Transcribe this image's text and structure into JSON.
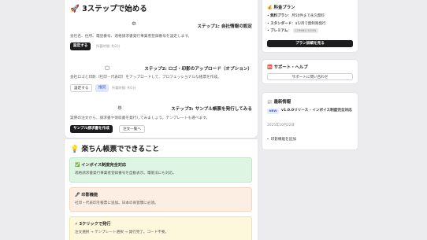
{
  "main": {
    "title": "🚀 3ステップで始める",
    "steps": [
      {
        "icon": "⚙",
        "title": "ステップ1: 会社情報の設定",
        "desc": "会社名、住所、電話番号、適格請求書発行事業者登録番号を設定します。",
        "button": "設定する",
        "hint": "所要時間: 約2分"
      },
      {
        "icon": "▢",
        "title": "ステップ2: ロゴ・印影のアップロード（オプション）",
        "desc": "会社ロゴと印影（社印・代表印）をアップロードして、プロフェッショナルな帳票を作成。",
        "button": "設定する",
        "button2": "推奨",
        "hint": "所要時間: 約1分"
      },
      {
        "icon": "⚙",
        "title": "ステップ3: サンプル帳票を発行してみる",
        "desc": "実際の注文から、請求書や領収書を発行してみましょう。テンプレートも選べます。",
        "button": "サンプル請求書を作成",
        "button2": "注文一覧へ"
      }
    ]
  },
  "features": {
    "title": "💡 楽ちん帳票でできること",
    "items": [
      {
        "title": "✅ インボイス制度完全対応",
        "desc": "適格請求書発行事業者登録番号を自動表示。電帳法にも対応。"
      },
      {
        "title": "🖊 印影機能",
        "desc": "社印・代表印を帳票に追加。日本の商習慣に必須。"
      },
      {
        "title": "⚡ 3クリックで発行",
        "desc": "注文選択 → テンプレート選択 → 発行完了。コード不要。"
      }
    ]
  },
  "sidebar": {
    "plan": {
      "title": "💰 料金プラン",
      "free_label": "無料プラン",
      "free_value": "：月50件まで永久無料",
      "standard_label": "スタンダード",
      "standard_value": "：$5/月で無制限発行",
      "premium_label": "プレミアム",
      "premium_suffix": "：",
      "soon": "COMING SOON",
      "button": "プラン詳細を見る"
    },
    "support": {
      "title": "🆘 サポート・ヘルプ",
      "button": "サポートに問い合わせ"
    },
    "news": {
      "title": "📰 最新情報",
      "badge": "NEW",
      "headline": "v1.0.0リリース - インボイス制度完全対応",
      "date": "2025年10月22日",
      "bullet": "印影機能を追加"
    }
  }
}
